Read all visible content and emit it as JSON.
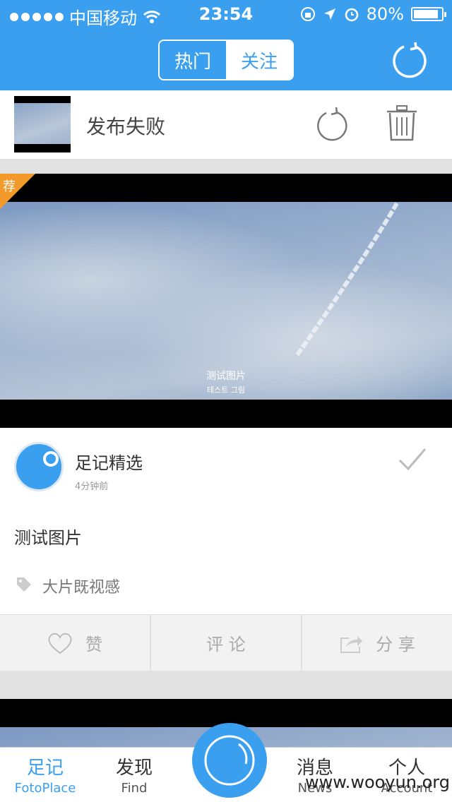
{
  "status": {
    "carrier": "中国移动",
    "time": "23:54",
    "battery": "80%"
  },
  "header": {
    "tab_hot": "热门",
    "tab_follow": "关注"
  },
  "failed_upload": {
    "label": "发布失败"
  },
  "card": {
    "badge": "荐",
    "image_caption_1": "测试图片",
    "image_caption_2": "테스트 그림",
    "author": "足记精选",
    "time_ago": "4分钟前",
    "description": "测试图片",
    "tag": "大片既视感",
    "like_label": "赞",
    "comment_label": "评 论",
    "share_label": "分 享"
  },
  "tabbar": {
    "items": [
      {
        "label": "足记",
        "sub": "FotoPlace"
      },
      {
        "label": "发现",
        "sub": "Find"
      },
      {
        "label": "消息",
        "sub": "News"
      },
      {
        "label": "个人",
        "sub": "Account"
      }
    ]
  },
  "watermark": "www.wooyun.org",
  "colors": {
    "accent": "#3b9ff0",
    "badge": "#f39a2a"
  }
}
